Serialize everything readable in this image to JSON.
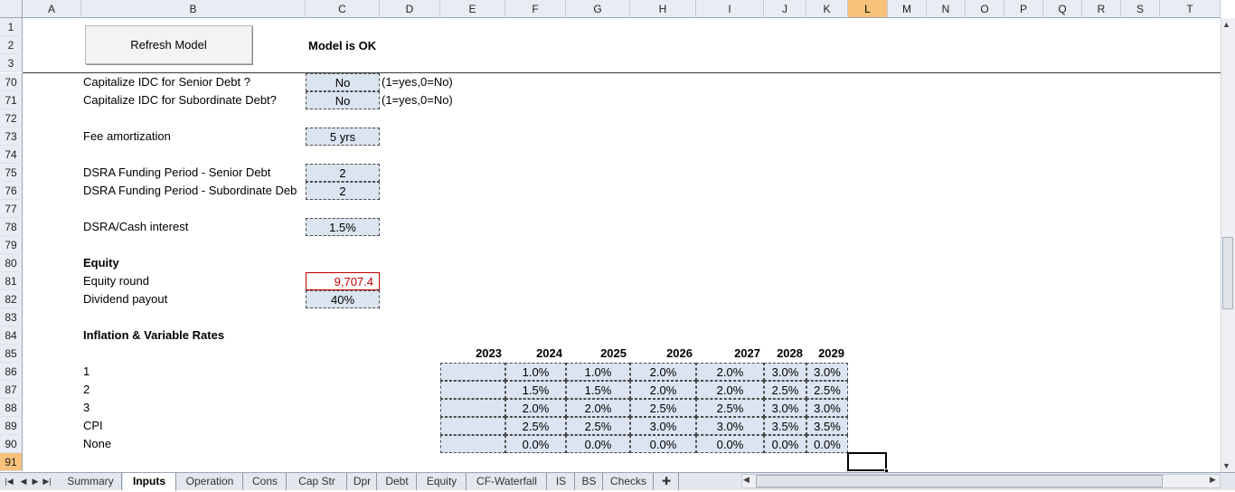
{
  "columns": [
    "A",
    "B",
    "C",
    "D",
    "E",
    "F",
    "G",
    "H",
    "I",
    "J",
    "K",
    "L",
    "M",
    "N",
    "O",
    "P",
    "Q",
    "R",
    "S",
    "T"
  ],
  "selected_column": "L",
  "selected_row": "91",
  "top_rows": [
    "1",
    "2",
    "3"
  ],
  "rows": [
    "70",
    "71",
    "72",
    "73",
    "74",
    "75",
    "76",
    "77",
    "78",
    "79",
    "80",
    "81",
    "82",
    "83",
    "84",
    "85",
    "86",
    "87",
    "88",
    "89",
    "90",
    "91"
  ],
  "header": {
    "refresh_button": "Refresh Model",
    "status": "Model is OK"
  },
  "inputs": {
    "cap_idc_senior": {
      "label": "Capitalize IDC for Senior Debt ?",
      "value": "No",
      "note": "(1=yes,0=No)"
    },
    "cap_idc_sub": {
      "label": "Capitalize IDC for Subordinate Debt?",
      "value": "No",
      "note": "(1=yes,0=No)"
    },
    "fee_amortization": {
      "label": "Fee amortization",
      "value": "5 yrs"
    },
    "dsra_senior": {
      "label": "DSRA Funding Period - Senior Debt",
      "value": "2"
    },
    "dsra_sub": {
      "label": "DSRA Funding Period - Subordinate Deb",
      "value": "2"
    },
    "dsra_interest": {
      "label": "DSRA/Cash interest",
      "value": "1.5%"
    },
    "equity_heading": "Equity",
    "equity_round": {
      "label": "Equity round",
      "value": "9,707.4"
    },
    "dividend_payout": {
      "label": "Dividend payout",
      "value": "40%"
    }
  },
  "inflation": {
    "heading": "Inflation & Variable Rates",
    "years": [
      "2023",
      "2024",
      "2025",
      "2026",
      "2027",
      "2028",
      "2029"
    ],
    "rows": [
      {
        "label": "1",
        "values": [
          "",
          "1.0%",
          "1.0%",
          "2.0%",
          "2.0%",
          "3.0%",
          "3.0%"
        ]
      },
      {
        "label": "2",
        "values": [
          "",
          "1.5%",
          "1.5%",
          "2.0%",
          "2.0%",
          "2.5%",
          "2.5%"
        ]
      },
      {
        "label": "3",
        "values": [
          "",
          "2.0%",
          "2.0%",
          "2.5%",
          "2.5%",
          "3.0%",
          "3.0%"
        ]
      },
      {
        "label": "CPI",
        "values": [
          "",
          "2.5%",
          "2.5%",
          "3.0%",
          "3.0%",
          "3.5%",
          "3.5%"
        ]
      },
      {
        "label": "None",
        "values": [
          "",
          "0.0%",
          "0.0%",
          "0.0%",
          "0.0%",
          "0.0%",
          "0.0%"
        ]
      }
    ]
  },
  "sheet_tabs": [
    "Summary",
    "Inputs",
    "Operation",
    "Cons",
    "Cap Str",
    "Dpr",
    "Debt",
    "Equity",
    "CF-Waterfall",
    "IS",
    "BS",
    "Checks"
  ],
  "active_tab": "Inputs",
  "colors": {
    "accent": "#f7c27b",
    "input_fill": "#dbe4f0",
    "error_red": "#c00000"
  }
}
